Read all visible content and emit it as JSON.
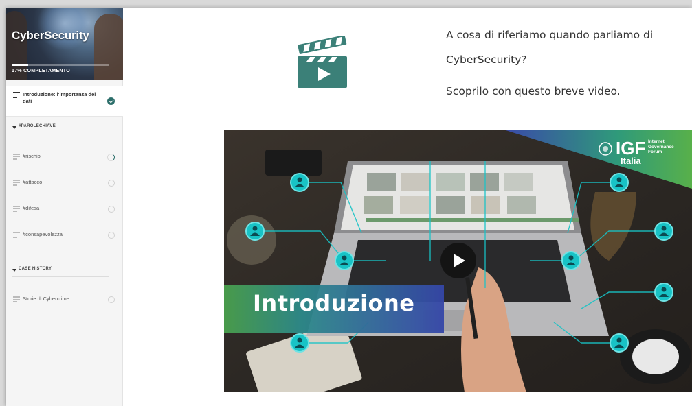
{
  "course": {
    "title": "CyberSecurity",
    "progress_label": "17% COMPLETAMENTO",
    "progress_percent": 17
  },
  "lessons_top": [
    {
      "label_line1": "Introduzione: l'importanza dei",
      "label_line2": "dati",
      "status": "complete"
    }
  ],
  "sections": [
    {
      "title": "#PAROLECHIAVE",
      "items": [
        {
          "label": "#rischio",
          "status": "in-progress"
        },
        {
          "label": "#attacco",
          "status": "not-started"
        },
        {
          "label": "#difesa",
          "status": "not-started"
        },
        {
          "label": "#consapevolezza",
          "status": "not-started"
        }
      ]
    },
    {
      "title": "CASE HISTORY",
      "items": [
        {
          "label": "Storie di Cybercrime",
          "status": "not-started"
        }
      ]
    }
  ],
  "main": {
    "line1": "A cosa di riferiamo quando parliamo di",
    "line2": "CyberSecurity?",
    "line3": "Scoprilo con questo breve video.",
    "video_caption": "Introduzione",
    "logo_main": "IGF",
    "logo_sub1": "Internet",
    "logo_sub2": "Governance",
    "logo_sub3": "Forum",
    "logo_country": "Italia"
  },
  "colors": {
    "accent": "#2c6e6a",
    "clapper": "#3b8078",
    "network": "#18c3c6"
  },
  "icons": [
    "menu-lines-icon",
    "check-icon",
    "clapperboard-icon",
    "play-icon",
    "user-node-icon",
    "un-emblem-icon"
  ]
}
